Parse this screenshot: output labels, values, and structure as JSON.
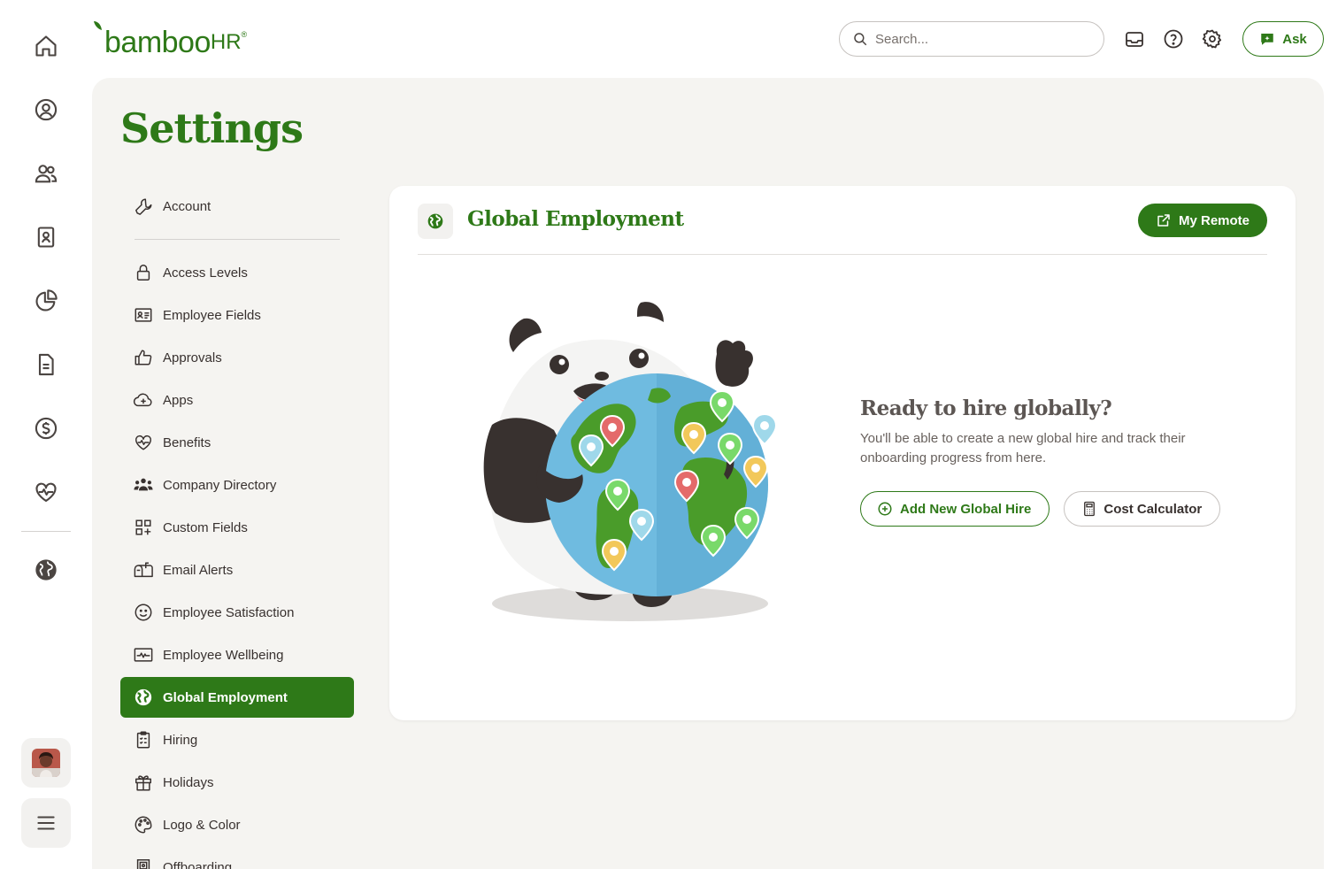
{
  "brand": {
    "logo_main": "bamboo",
    "logo_suffix": "HR",
    "color": "#2e7918"
  },
  "rail": {
    "items": [
      {
        "name": "home-icon"
      },
      {
        "name": "profile-icon"
      },
      {
        "name": "people-icon"
      },
      {
        "name": "directory-icon"
      },
      {
        "name": "reports-icon"
      },
      {
        "name": "files-icon"
      },
      {
        "name": "payroll-icon"
      },
      {
        "name": "benefits-icon"
      },
      {
        "name": "globe-icon"
      }
    ],
    "menu_icon": "hamburger-icon"
  },
  "header": {
    "search_placeholder": "Search...",
    "ask_label": "Ask"
  },
  "page": {
    "title": "Settings"
  },
  "settings_nav": {
    "account": "Account",
    "items": [
      {
        "label": "Access Levels",
        "icon": "lock-icon"
      },
      {
        "label": "Employee Fields",
        "icon": "id-card-icon"
      },
      {
        "label": "Approvals",
        "icon": "thumbs-up-icon"
      },
      {
        "label": "Apps",
        "icon": "cloud-plus-icon"
      },
      {
        "label": "Benefits",
        "icon": "heart-pulse-icon"
      },
      {
        "label": "Company Directory",
        "icon": "people-group-icon"
      },
      {
        "label": "Custom Fields",
        "icon": "grid-plus-icon"
      },
      {
        "label": "Email Alerts",
        "icon": "mailbox-icon"
      },
      {
        "label": "Employee Satisfaction",
        "icon": "smile-icon"
      },
      {
        "label": "Employee Wellbeing",
        "icon": "wellbeing-icon"
      },
      {
        "label": "Global Employment",
        "icon": "globe-icon",
        "active": true
      },
      {
        "label": "Hiring",
        "icon": "clipboard-icon"
      },
      {
        "label": "Holidays",
        "icon": "gift-icon"
      },
      {
        "label": "Logo & Color",
        "icon": "palette-icon"
      },
      {
        "label": "Offboarding",
        "icon": "door-icon"
      }
    ]
  },
  "card": {
    "title": "Global Employment",
    "my_remote_label": "My Remote",
    "cta_title": "Ready to hire globally?",
    "cta_desc": "You'll be able to create a new global hire and track their onboarding progress from here.",
    "add_hire_label": "Add New Global Hire",
    "cost_calc_label": "Cost Calculator"
  }
}
